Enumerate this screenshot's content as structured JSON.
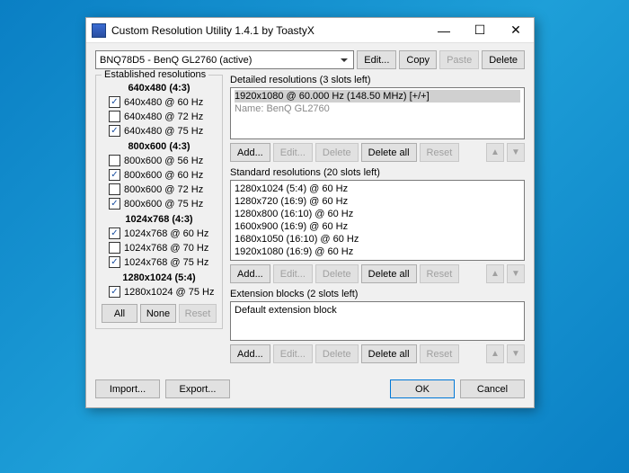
{
  "window": {
    "title": "Custom Resolution Utility 1.4.1 by ToastyX"
  },
  "monitor": {
    "selected": "BNQ78D5 - BenQ GL2760 (active)",
    "edit": "Edit...",
    "copy": "Copy",
    "paste": "Paste",
    "delete": "Delete"
  },
  "established": {
    "label": "Established resolutions",
    "groups": [
      {
        "header": "640x480 (4:3)",
        "items": [
          {
            "label": "640x480 @ 60 Hz",
            "checked": true
          },
          {
            "label": "640x480 @ 72 Hz",
            "checked": false
          },
          {
            "label": "640x480 @ 75 Hz",
            "checked": true
          }
        ]
      },
      {
        "header": "800x600 (4:3)",
        "items": [
          {
            "label": "800x600 @ 56 Hz",
            "checked": false
          },
          {
            "label": "800x600 @ 60 Hz",
            "checked": true
          },
          {
            "label": "800x600 @ 72 Hz",
            "checked": false
          },
          {
            "label": "800x600 @ 75 Hz",
            "checked": true
          }
        ]
      },
      {
        "header": "1024x768 (4:3)",
        "items": [
          {
            "label": "1024x768 @ 60 Hz",
            "checked": true
          },
          {
            "label": "1024x768 @ 70 Hz",
            "checked": false
          },
          {
            "label": "1024x768 @ 75 Hz",
            "checked": true
          }
        ]
      },
      {
        "header": "1280x1024 (5:4)",
        "items": [
          {
            "label": "1280x1024 @ 75 Hz",
            "checked": true
          }
        ]
      }
    ],
    "all": "All",
    "none": "None",
    "reset": "Reset"
  },
  "detailed": {
    "label": "Detailed resolutions (3 slots left)",
    "line1": "1920x1080 @ 60.000 Hz (148.50 MHz) [+/+]",
    "line2": "Name: BenQ GL2760",
    "add": "Add...",
    "edit": "Edit...",
    "delete": "Delete",
    "deleteall": "Delete all",
    "reset": "Reset"
  },
  "standard": {
    "label": "Standard resolutions (20 slots left)",
    "items": [
      "1280x1024 (5:4) @ 60 Hz",
      "1280x720 (16:9) @ 60 Hz",
      "1280x800 (16:10) @ 60 Hz",
      "1600x900 (16:9) @ 60 Hz",
      "1680x1050 (16:10) @ 60 Hz",
      "1920x1080 (16:9) @ 60 Hz"
    ],
    "add": "Add...",
    "edit": "Edit...",
    "delete": "Delete",
    "deleteall": "Delete all",
    "reset": "Reset"
  },
  "extension": {
    "label": "Extension blocks (2 slots left)",
    "item": "Default extension block",
    "add": "Add...",
    "edit": "Edit...",
    "delete": "Delete",
    "deleteall": "Delete all",
    "reset": "Reset"
  },
  "footer": {
    "import": "Import...",
    "export": "Export...",
    "ok": "OK",
    "cancel": "Cancel"
  }
}
